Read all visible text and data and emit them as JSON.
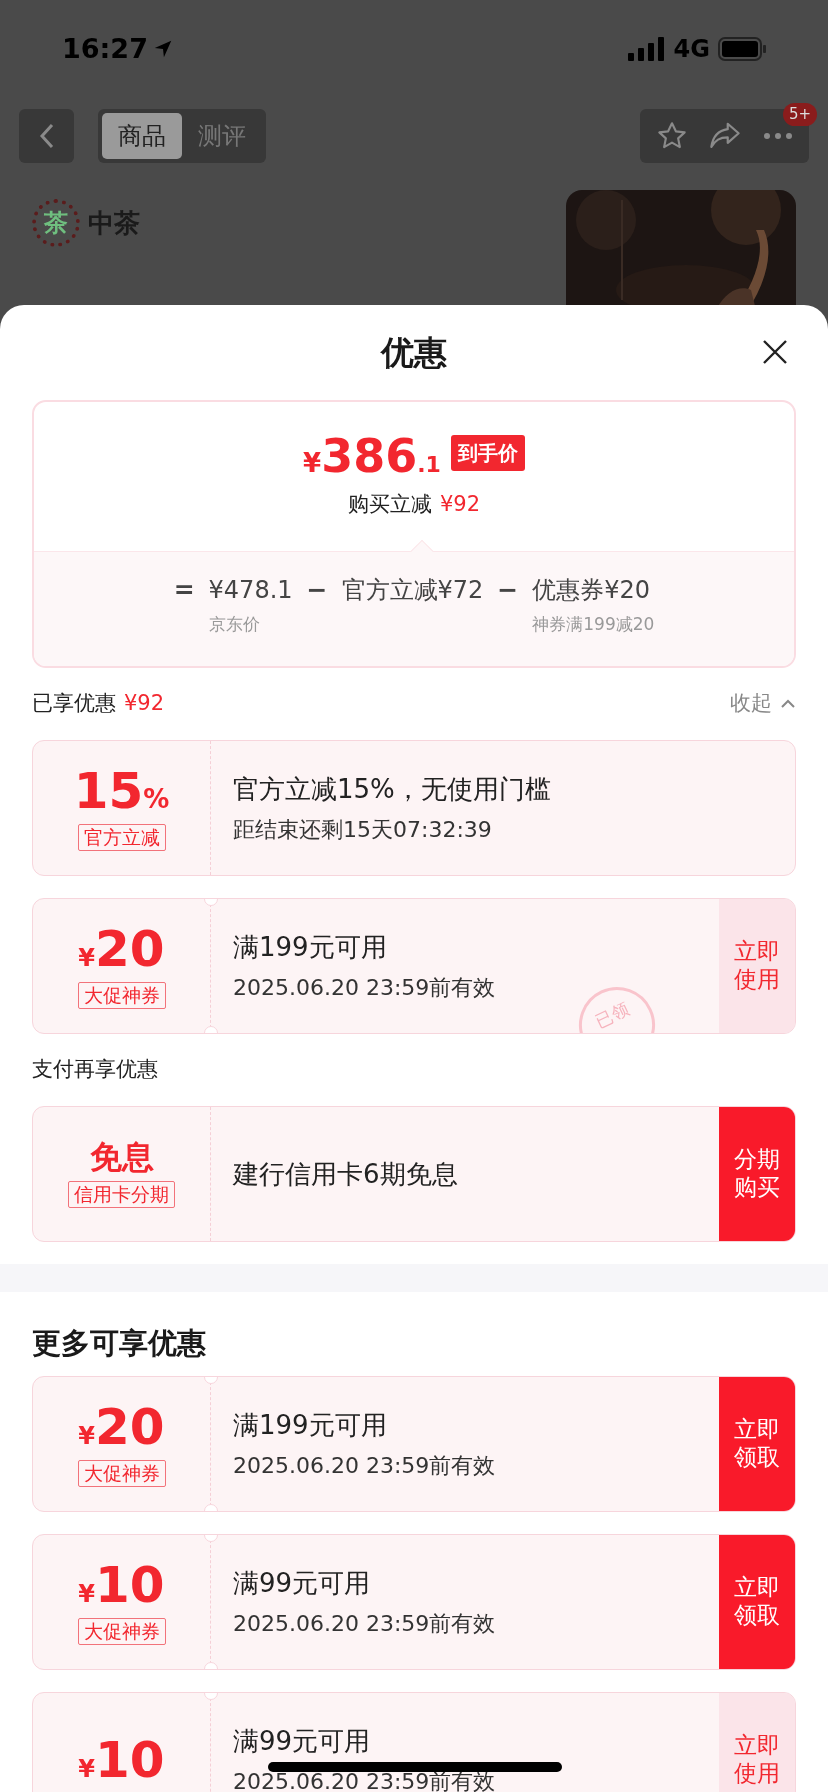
{
  "status_bar": {
    "time": "16:27",
    "network": "4G"
  },
  "nav": {
    "tabs": [
      {
        "label": "商品",
        "selected": true
      },
      {
        "label": "测评",
        "selected": false
      }
    ],
    "badge": "5+"
  },
  "brand": {
    "name": "中茶",
    "mark": "茶"
  },
  "sheet": {
    "title": "优惠",
    "price": {
      "currency": "¥",
      "integer": "386",
      "decimal": ".1",
      "tag": "到手价",
      "saving_label": "购买立减",
      "saving": "¥92"
    },
    "formula": [
      {
        "kind": "op",
        "text": "="
      },
      {
        "kind": "term",
        "text": "¥478.1",
        "note": "京东价"
      },
      {
        "kind": "op",
        "text": "−"
      },
      {
        "kind": "term",
        "text": "官方立减¥72"
      },
      {
        "kind": "op",
        "text": "−"
      },
      {
        "kind": "term",
        "text": "优惠券¥20",
        "note": "神券满199减20"
      }
    ],
    "sections": [
      {
        "title": "已享优惠",
        "amount": "¥92",
        "toggle": "收起",
        "expanded": true,
        "kind": "small",
        "coupons": [
          {
            "kind": "percent",
            "amount": "15",
            "unit": "%",
            "tag": "官方立减",
            "title": "官方立减15%，无使用门槛",
            "subtitle": "距结束还剩15天07:32:39",
            "notched": false
          },
          {
            "kind": "cash",
            "unit": "¥",
            "amount": "20",
            "tag": "大促神券",
            "title": "满199元可用",
            "subtitle": "2025.06.20 23:59前有效",
            "notched": true,
            "claimed": true,
            "stamp": "已领",
            "button": {
              "label": "立即使用",
              "solid": false
            }
          }
        ]
      },
      {
        "title": "支付再享优惠",
        "kind": "small",
        "coupons": [
          {
            "kind": "text",
            "amount": "免息",
            "tag": "信用卡分期",
            "title": "建行信用卡6期免息",
            "notched": false,
            "button": {
              "label": "分期购买",
              "solid": true
            }
          }
        ]
      },
      {
        "title": "更多可享优惠",
        "kind": "large",
        "divider": true,
        "coupons": [
          {
            "kind": "cash",
            "unit": "¥",
            "amount": "20",
            "tag": "大促神券",
            "title": "满199元可用",
            "subtitle": "2025.06.20 23:59前有效",
            "notched": true,
            "button": {
              "label": "立即领取",
              "solid": true
            }
          },
          {
            "kind": "cash",
            "unit": "¥",
            "amount": "10",
            "tag": "大促神券",
            "title": "满99元可用",
            "subtitle": "2025.06.20 23:59前有效",
            "notched": true,
            "button": {
              "label": "立即领取",
              "solid": true
            }
          },
          {
            "kind": "cash",
            "unit": "¥",
            "amount": "10",
            "title": "满99元可用",
            "subtitle": "2025.06.20 23:59前有效",
            "notched": true,
            "button": {
              "label": "立即使用",
              "solid": false
            }
          }
        ]
      }
    ]
  }
}
